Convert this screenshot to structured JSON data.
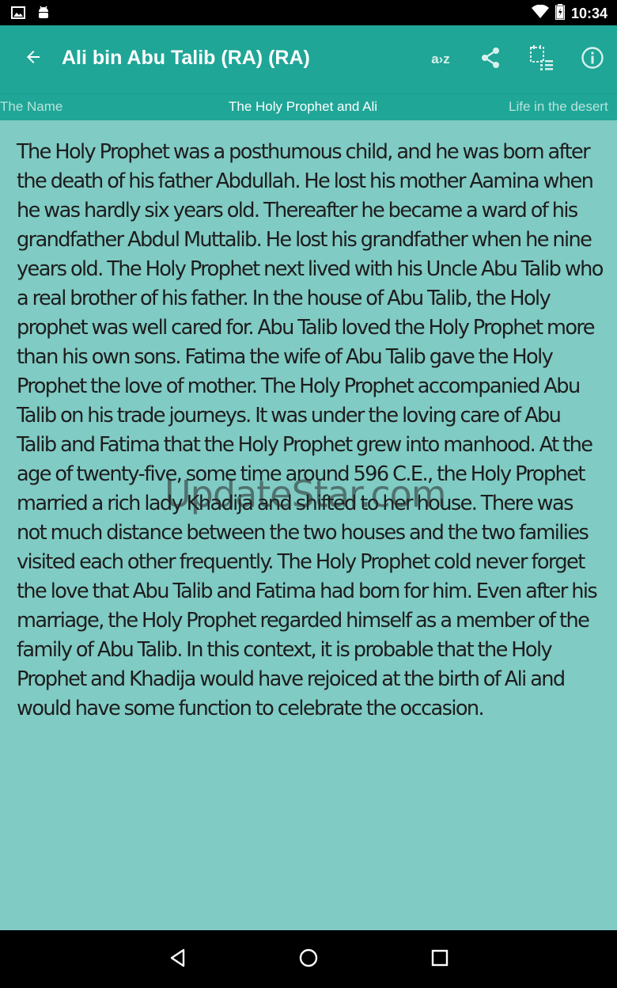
{
  "status_bar": {
    "time": "10:34",
    "icons": [
      "image-icon",
      "android-icon",
      "wifi-icon",
      "battery-icon"
    ]
  },
  "app_bar": {
    "title": "Ali bin Abu Talib (RA) (RA)",
    "back_icon": "arrow-back-icon",
    "actions": [
      {
        "name": "az-sort-icon",
        "label": "a›z"
      },
      {
        "name": "share-icon"
      },
      {
        "name": "chapter-list-icon"
      },
      {
        "name": "info-icon"
      }
    ]
  },
  "tabs": {
    "prev": "The Name",
    "current": "The Holy Prophet and Ali",
    "next": "Life in the desert"
  },
  "article": {
    "text": "The Holy Prophet was a posthumous child, and he was born after the death of his father Abdullah. He lost his mother Aamina when he was hardly six years old. Thereafter he became a ward of his grandfather Abdul Muttalib. He lost his grandfather when he nine years old. The Holy Prophet next lived with his Uncle Abu Talib who a real brother of his father. In the house of Abu Talib, the Holy prophet was well cared for. Abu Talib loved the Holy Prophet more than his own sons. Fatima the wife of Abu Talib gave the Holy Prophet the love of mother. The Holy Prophet accompanied Abu Talib on his trade journeys. It was under the loving care of Abu Talib and Fatima that the Holy Prophet grew into manhood. At the age of twenty-five, some time around 596 C.E., the Holy Prophet married a rich lady Khadija and shifted to her house. There was not much distance between the two houses and the two families visited each other frequently. The Holy Prophet cold never forget the love that Abu Talib and Fatima had born for him. Even after his marriage, the Holy Prophet regarded himself as a member of the family of Abu Talib. In this context, it is probable that the Holy Prophet and Khadija would have rejoiced at the birth of Ali and would have some function to celebrate the occasion."
  },
  "watermark": "UpdateStar.com",
  "nav_bar": {
    "buttons": [
      "back-triangle-icon",
      "home-circle-icon",
      "recents-square-icon"
    ]
  },
  "colors": {
    "app_bar": "#1FA697",
    "background": "#80CBC4",
    "text": "#1d1d1d"
  }
}
